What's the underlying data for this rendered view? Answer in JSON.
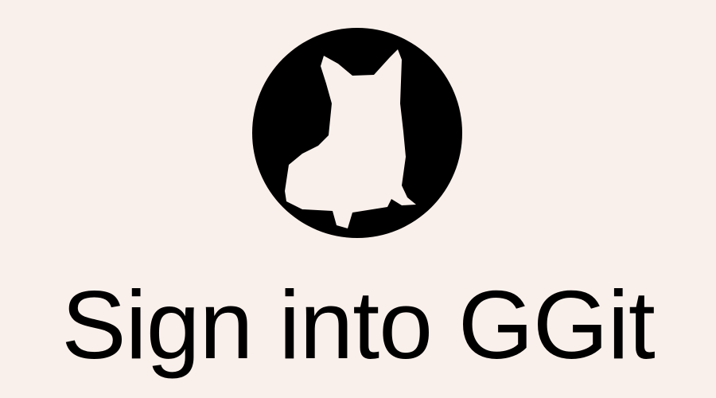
{
  "logo": {
    "icon": "corgi-silhouette-logo",
    "colors": {
      "circle": "#000000",
      "silhouette": "#FAF0EB"
    }
  },
  "title": "Sign into GGit",
  "colors": {
    "background": "#FAF0EB",
    "text": "#000000"
  }
}
